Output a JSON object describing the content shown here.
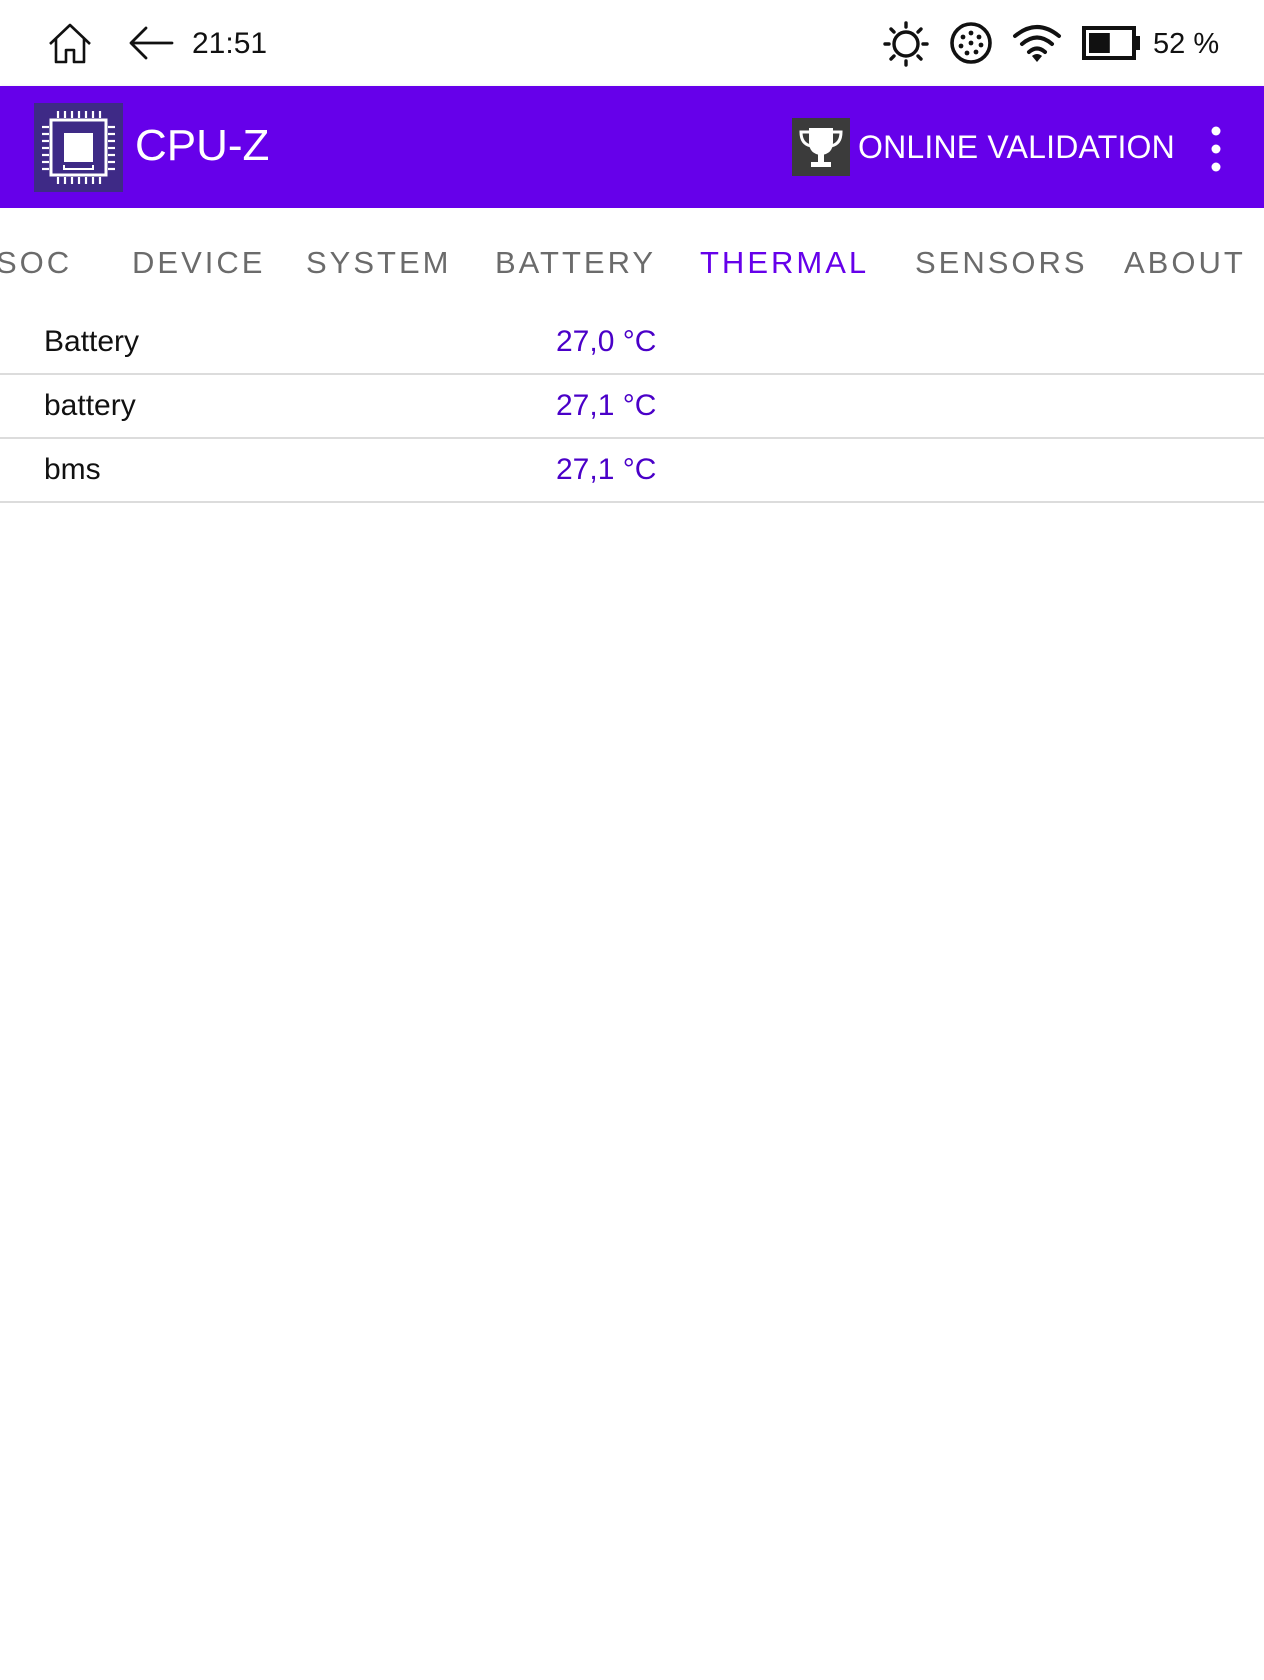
{
  "status_bar": {
    "time": "21:51",
    "battery_percent": "52 %",
    "battery_level": 0.52,
    "icons": [
      "home-icon",
      "back-arrow-icon",
      "brightness-icon",
      "sync-dots-icon",
      "wifi-icon",
      "battery-icon"
    ]
  },
  "app_bar": {
    "title": "CPU-Z",
    "validation_label": "ONLINE VALIDATION",
    "colors": {
      "app_bar_bg": "#6600ea",
      "logo_bg": "#3e2a86",
      "accent_text": "#4a00c8"
    }
  },
  "tabs": [
    {
      "label": "SOC",
      "active": false
    },
    {
      "label": "DEVICE",
      "active": false
    },
    {
      "label": "SYSTEM",
      "active": false
    },
    {
      "label": "BATTERY",
      "active": false
    },
    {
      "label": "THERMAL",
      "active": true
    },
    {
      "label": "SENSORS",
      "active": false
    },
    {
      "label": "ABOUT",
      "active": false
    }
  ],
  "thermal": {
    "rows": [
      {
        "label": "Battery",
        "value": "27,0 °C"
      },
      {
        "label": "battery",
        "value": "27,1 °C"
      },
      {
        "label": "bms",
        "value": "27,1 °C"
      }
    ]
  }
}
